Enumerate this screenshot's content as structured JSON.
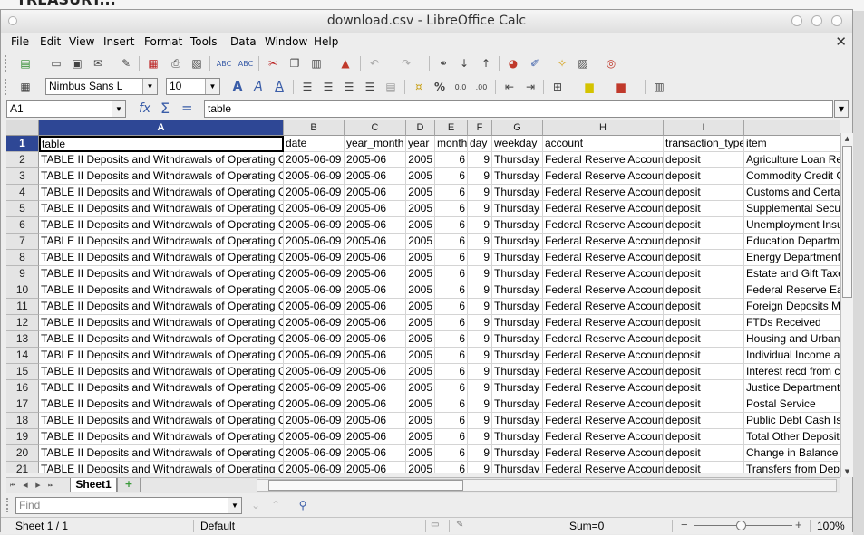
{
  "window": {
    "title": "download.csv - LibreOffice Calc"
  },
  "menubar": {
    "items": [
      "File",
      "Edit",
      "View",
      "Insert",
      "Format",
      "Tools",
      "Data",
      "Window",
      "Help"
    ]
  },
  "formatting": {
    "font_name": "Nimbus Sans L",
    "font_size": "10"
  },
  "formula_bar": {
    "cell_ref": "A1",
    "content": "table"
  },
  "grid": {
    "columns": [
      "A",
      "B",
      "C",
      "D",
      "E",
      "F",
      "G",
      "H",
      "I"
    ],
    "row_numbers": [
      "1",
      "2",
      "3",
      "4",
      "5",
      "6",
      "7",
      "8",
      "9",
      "10",
      "11",
      "12",
      "13",
      "14",
      "15",
      "16",
      "17",
      "18",
      "19",
      "20",
      "21"
    ],
    "rows": [
      [
        "table",
        "date",
        "year_month",
        "year",
        "month",
        "day",
        "weekday",
        "account",
        "transaction_type",
        "item"
      ],
      [
        "TABLE II Deposits and Withdrawals of Operating Cash",
        "2005-06-09",
        "2005-06",
        "2005",
        "6",
        "9",
        "Thursday",
        "Federal Reserve Account",
        "deposit",
        "Agriculture Loan Repayments"
      ],
      [
        "TABLE II Deposits and Withdrawals of Operating Cash",
        "2005-06-09",
        "2005-06",
        "2005",
        "6",
        "9",
        "Thursday",
        "Federal Reserve Account",
        "deposit",
        "Commodity Credit Corporation"
      ],
      [
        "TABLE II Deposits and Withdrawals of Operating Cash",
        "2005-06-09",
        "2005-06",
        "2005",
        "6",
        "9",
        "Thursday",
        "Federal Reserve Account",
        "deposit",
        "Customs and Certain Excise"
      ],
      [
        "TABLE II Deposits and Withdrawals of Operating Cash",
        "2005-06-09",
        "2005-06",
        "2005",
        "6",
        "9",
        "Thursday",
        "Federal Reserve Account",
        "deposit",
        "Supplemental Security"
      ],
      [
        "TABLE II Deposits and Withdrawals of Operating Cash",
        "2005-06-09",
        "2005-06",
        "2005",
        "6",
        "9",
        "Thursday",
        "Federal Reserve Account",
        "deposit",
        "Unemployment Insurance"
      ],
      [
        "TABLE II Deposits and Withdrawals of Operating Cash",
        "2005-06-09",
        "2005-06",
        "2005",
        "6",
        "9",
        "Thursday",
        "Federal Reserve Account",
        "deposit",
        "Education Department"
      ],
      [
        "TABLE II Deposits and Withdrawals of Operating Cash",
        "2005-06-09",
        "2005-06",
        "2005",
        "6",
        "9",
        "Thursday",
        "Federal Reserve Account",
        "deposit",
        "Energy Department"
      ],
      [
        "TABLE II Deposits and Withdrawals of Operating Cash",
        "2005-06-09",
        "2005-06",
        "2005",
        "6",
        "9",
        "Thursday",
        "Federal Reserve Account",
        "deposit",
        "Estate and Gift Taxes"
      ],
      [
        "TABLE II Deposits and Withdrawals of Operating Cash",
        "2005-06-09",
        "2005-06",
        "2005",
        "6",
        "9",
        "Thursday",
        "Federal Reserve Account",
        "deposit",
        "Federal Reserve Earnings"
      ],
      [
        "TABLE II Deposits and Withdrawals of Operating Cash",
        "2005-06-09",
        "2005-06",
        "2005",
        "6",
        "9",
        "Thursday",
        "Federal Reserve Account",
        "deposit",
        "Foreign Deposits Military"
      ],
      [
        "TABLE II Deposits and Withdrawals of Operating Cash",
        "2005-06-09",
        "2005-06",
        "2005",
        "6",
        "9",
        "Thursday",
        "Federal Reserve Account",
        "deposit",
        "FTDs Received"
      ],
      [
        "TABLE II Deposits and Withdrawals of Operating Cash",
        "2005-06-09",
        "2005-06",
        "2005",
        "6",
        "9",
        "Thursday",
        "Federal Reserve Account",
        "deposit",
        "Housing and Urban Dev"
      ],
      [
        "TABLE II Deposits and Withdrawals of Operating Cash",
        "2005-06-09",
        "2005-06",
        "2005",
        "6",
        "9",
        "Thursday",
        "Federal Reserve Account",
        "deposit",
        "Individual Income and"
      ],
      [
        "TABLE II Deposits and Withdrawals of Operating Cash",
        "2005-06-09",
        "2005-06",
        "2005",
        "6",
        "9",
        "Thursday",
        "Federal Reserve Account",
        "deposit",
        "Interest recd from cash"
      ],
      [
        "TABLE II Deposits and Withdrawals of Operating Cash",
        "2005-06-09",
        "2005-06",
        "2005",
        "6",
        "9",
        "Thursday",
        "Federal Reserve Account",
        "deposit",
        "Justice Department pro"
      ],
      [
        "TABLE II Deposits and Withdrawals of Operating Cash",
        "2005-06-09",
        "2005-06",
        "2005",
        "6",
        "9",
        "Thursday",
        "Federal Reserve Account",
        "deposit",
        "Postal Service"
      ],
      [
        "TABLE II Deposits and Withdrawals of Operating Cash",
        "2005-06-09",
        "2005-06",
        "2005",
        "6",
        "9",
        "Thursday",
        "Federal Reserve Account",
        "deposit",
        "Public Debt Cash Issues"
      ],
      [
        "TABLE II Deposits and Withdrawals of Operating Cash",
        "2005-06-09",
        "2005-06",
        "2005",
        "6",
        "9",
        "Thursday",
        "Federal Reserve Account",
        "deposit",
        "Total Other Deposits"
      ],
      [
        "TABLE II Deposits and Withdrawals of Operating Cash",
        "2005-06-09",
        "2005-06",
        "2005",
        "6",
        "9",
        "Thursday",
        "Federal Reserve Account",
        "deposit",
        "Change in Balance of"
      ],
      [
        "TABLE II Deposits and Withdrawals of Operating Cash",
        "2005-06-09",
        "2005-06",
        "2005",
        "6",
        "9",
        "Thursday",
        "Federal Reserve Account",
        "deposit",
        "Transfers from Depos"
      ]
    ]
  },
  "sheet_tabs": {
    "active": "Sheet1"
  },
  "find": {
    "placeholder": "Find"
  },
  "status": {
    "sheet": "Sheet 1 / 1",
    "style": "Default",
    "sum": "Sum=0",
    "zoom": "100%"
  },
  "colors": {
    "selection": "#2e4795",
    "accent": "#3a5da8"
  }
}
